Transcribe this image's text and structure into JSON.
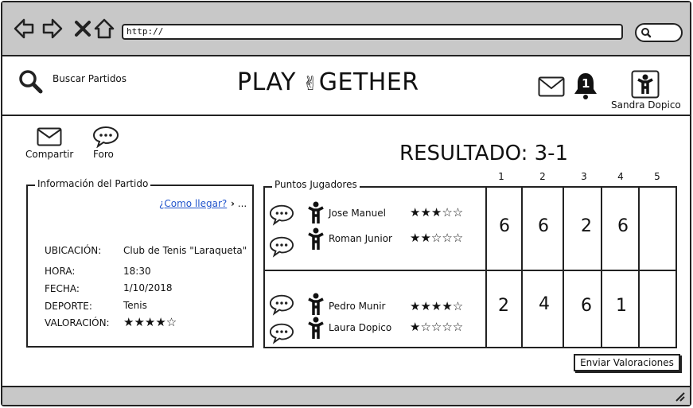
{
  "browser": {
    "url": "http://"
  },
  "header": {
    "search_label": "Buscar Partidos",
    "logo_left": "PLAY",
    "logo_right": "GETHER",
    "notification_count": "1",
    "user_name": "Sandra Dopico"
  },
  "actions": {
    "share_label": "Compartir",
    "forum_label": "Foro"
  },
  "result": {
    "label": "RESULTADO: 3-1"
  },
  "match_info": {
    "title": "Información del Partido",
    "directions_link": "¿Como llegar?",
    "directions_more": "...",
    "fields": [
      {
        "label": "UBICACIÓN:",
        "value": "Club de Tenis \"Laraqueta\""
      },
      {
        "label": "HORA:",
        "value": "18:30"
      },
      {
        "label": "FECHA:",
        "value": "1/10/2018"
      },
      {
        "label": "DEPORTE:",
        "value": "Tenis"
      },
      {
        "label": "VALORACIÓN:",
        "value": "★★★★☆"
      }
    ],
    "rating": 4
  },
  "players_panel": {
    "title": "Puntos Jugadores",
    "set_columns": [
      "1",
      "2",
      "3",
      "4",
      "5"
    ],
    "teams": [
      {
        "players": [
          {
            "name": "Jose Manuel",
            "stars": "★★★☆☆",
            "rating": 3
          },
          {
            "name": "Roman Junior",
            "stars": "★★☆☆☆",
            "rating": 2
          }
        ],
        "scores": [
          "6",
          "6",
          "2",
          "6",
          ""
        ]
      },
      {
        "players": [
          {
            "name": "Pedro Munir",
            "stars": "★★★★☆",
            "rating": 4
          },
          {
            "name": "Laura Dopico",
            "stars": "★☆☆☆☆",
            "rating": 1
          }
        ],
        "scores": [
          "2",
          "4",
          "6",
          "1",
          ""
        ]
      }
    ]
  },
  "send_button_label": "Enviar Valoraciones"
}
